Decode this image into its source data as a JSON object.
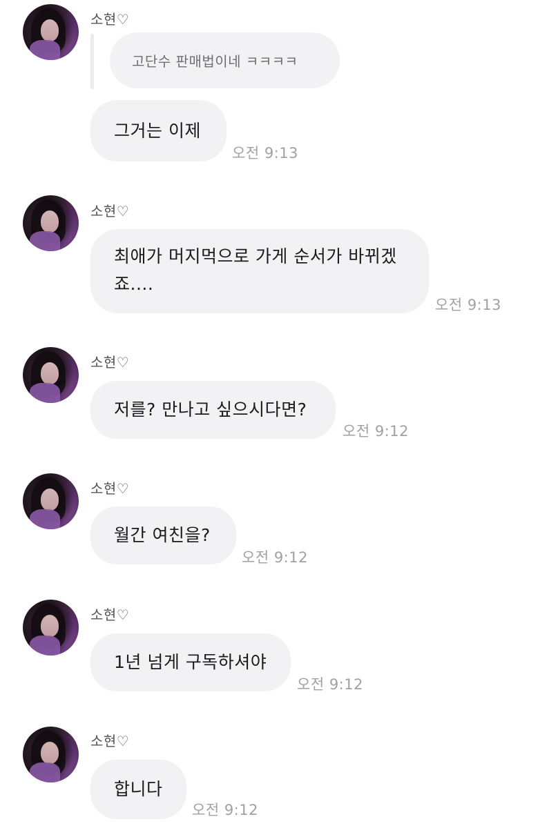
{
  "messages": [
    {
      "sender": "소현♡",
      "quote": "고단수 판매법이네 ㅋㅋㅋㅋ",
      "text": "그거는 이제",
      "time": "오전 9:13"
    },
    {
      "sender": "소현♡",
      "text_line1": "최애가 머지먹으로 가게 순서가 바뀌겠",
      "text_line2": "죠....",
      "time": "오전 9:13"
    },
    {
      "sender": "소현♡",
      "text": "저를? 만나고 싶으시다면?",
      "time": "오전 9:12"
    },
    {
      "sender": "소현♡",
      "text": "월간 여친을?",
      "time": "오전 9:12"
    },
    {
      "sender": "소현♡",
      "text": "1년 넘게 구독하셔야",
      "time": "오전 9:12"
    },
    {
      "sender": "소현♡",
      "text": "합니다",
      "time": "오전 9:12"
    }
  ]
}
